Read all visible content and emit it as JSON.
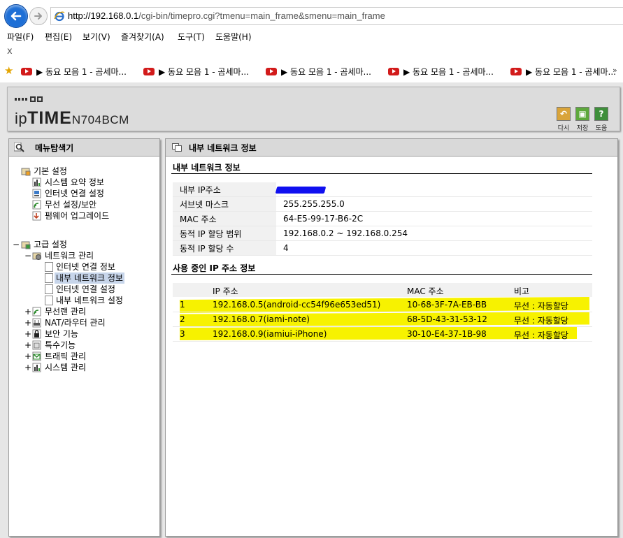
{
  "browser": {
    "address_url_host": "http://192.168.0.1",
    "address_url_path": "/cgi-bin/timepro.cgi?tmenu=main_frame&smenu=main_frame",
    "menu": [
      "파일(F)",
      "편집(E)",
      "보기(V)",
      "즐겨찾기(A)",
      "도구(T)",
      "도움말(H)"
    ],
    "close_label": "x",
    "favorites": [
      "▶ 동요 모음 1 - 곰세마...",
      "▶ 동요 모음 1 - 곰세마...",
      "▶ 동요 모음 1 - 곰세마...",
      "▶ 동요 모음 1 - 곰세마...",
      "▶ 동요 모음 1 - 곰세마..."
    ],
    "favorites_more": "»"
  },
  "router": {
    "logo_ip": "ip",
    "logo_time": "TIME",
    "logo_model": "N704BCM",
    "header_buttons": [
      {
        "label": "다시",
        "color": "#d9a43a"
      },
      {
        "label": "저장",
        "color": "#5da83c"
      },
      {
        "label": "도움",
        "color": "#3e8f3a"
      }
    ],
    "sidebar": {
      "title": "메뉴탐색기",
      "basic": {
        "label": "기본 설정",
        "items": [
          "시스템 요약 정보",
          "인터넷 연결 설정",
          "무선 설정/보안",
          "펌웨어 업그레이드"
        ]
      },
      "advanced": {
        "label": "고급 설정",
        "expander": "−",
        "network": {
          "label": "네트워크 관리",
          "expander": "−",
          "items": [
            "인터넷 연결 정보",
            "내부 네트워크 정보",
            "인터넷 연결 설정",
            "내부 네트워크 설정"
          ],
          "selected_index": 1
        },
        "groups": [
          "무선랜 관리",
          "NAT/라우터 관리",
          "보안 기능",
          "특수기능",
          "트래픽 관리",
          "시스템 관리"
        ],
        "group_expander": "+"
      }
    },
    "main": {
      "title": "내부 네트워크 정보",
      "section1": "내부 네트워크 정보",
      "info": [
        {
          "key": "내부 IP주소",
          "value": ""
        },
        {
          "key": "서브넷 마스크",
          "value": "255.255.255.0"
        },
        {
          "key": "MAC 주소",
          "value": "64-E5-99-17-B6-2C"
        },
        {
          "key": "동적 IP 할당 범위",
          "value": "192.168.0.2 ~  192.168.0.254"
        },
        {
          "key": "동적 IP 할당 수",
          "value": "4"
        }
      ],
      "section2": "사용 중인 IP 주소 정보",
      "client_headers": {
        "ip": "IP 주소",
        "mac": "MAC 주소",
        "note": "비고"
      },
      "clients": [
        {
          "no": "1",
          "ip": "192.168.0.5(android-cc54f96e653ed51)",
          "mac": "10-68-3F-7A-EB-BB",
          "note": "무선 : 자동할당"
        },
        {
          "no": "2",
          "ip": "192.168.0.7(iami-note)",
          "mac": "68-5D-43-31-53-12",
          "note": "무선 : 자동할당"
        },
        {
          "no": "3",
          "ip": "192.168.0.9(iamiui-iPhone)",
          "mac": "30-10-E4-37-1B-98",
          "note": "무선 : 자동할당"
        }
      ],
      "highlight_color": "#f7f200"
    }
  }
}
